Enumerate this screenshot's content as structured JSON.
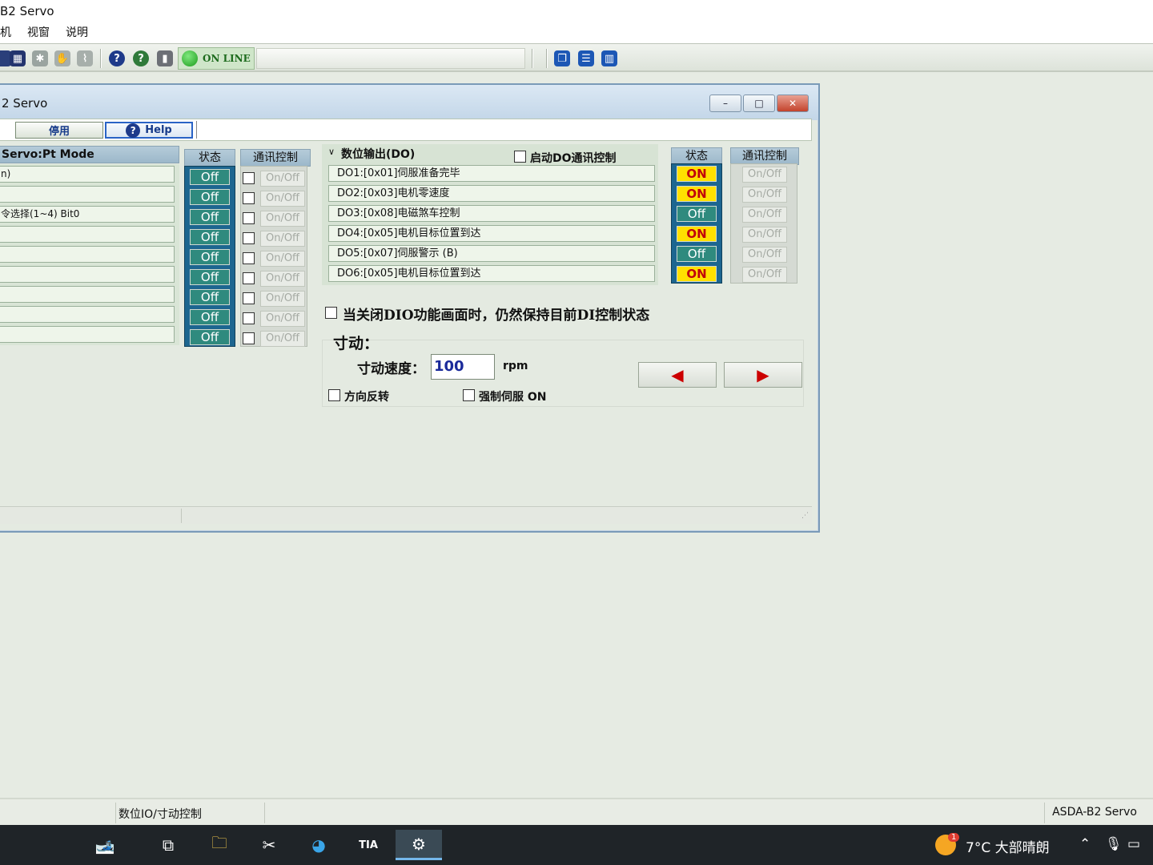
{
  "app": {
    "title": "B2 Servo",
    "menu": [
      "机",
      "视窗",
      "说明"
    ]
  },
  "toolbar": {
    "online_label": "ON LINE"
  },
  "window": {
    "title": "2 Servo",
    "buttons": {
      "minimize": "–",
      "restore": "□",
      "close": "✕"
    },
    "tool_disable": "停用",
    "tool_help": "Help"
  },
  "di": {
    "header": "Servo:Pt Mode",
    "state_header": "状态",
    "comm_header": "通讯控制",
    "rows": [
      {
        "label": "n)",
        "state": "Off",
        "comm": "On/Off"
      },
      {
        "label": "",
        "state": "Off",
        "comm": "On/Off"
      },
      {
        "label": "令选择(1~4) Bit0",
        "state": "Off",
        "comm": "On/Off"
      },
      {
        "label": "",
        "state": "Off",
        "comm": "On/Off"
      },
      {
        "label": "",
        "state": "Off",
        "comm": "On/Off"
      },
      {
        "label": "",
        "state": "Off",
        "comm": "On/Off"
      },
      {
        "label": "",
        "state": "Off",
        "comm": "On/Off"
      },
      {
        "label": "",
        "state": "Off",
        "comm": "On/Off"
      },
      {
        "label": "",
        "state": "Off",
        "comm": "On/Off"
      }
    ]
  },
  "do": {
    "header": "数位输出(DO)",
    "enable_comm": "启动DO通讯控制",
    "state_header": "状态",
    "comm_header": "通讯控制",
    "rows": [
      {
        "label": "DO1:[0x01]伺服准备完毕",
        "state": "ON",
        "comm": "On/Off"
      },
      {
        "label": "DO2:[0x03]电机零速度",
        "state": "ON",
        "comm": "On/Off"
      },
      {
        "label": "DO3:[0x08]电磁煞车控制",
        "state": "Off",
        "comm": "On/Off"
      },
      {
        "label": "DO4:[0x05]电机目标位置到达",
        "state": "ON",
        "comm": "On/Off"
      },
      {
        "label": "DO5:[0x07]伺服警示 (B)",
        "state": "Off",
        "comm": "On/Off"
      },
      {
        "label": "DO6:[0x05]电机目标位置到达",
        "state": "ON",
        "comm": "On/Off"
      }
    ]
  },
  "keep_state": "当关闭DIO功能画面时，仍然保持目前DI控制状态",
  "jog": {
    "title": "寸动：",
    "speed_label": "寸动速度：",
    "speed_value": "100",
    "unit": "rpm",
    "reverse": "方向反转",
    "force_servo": "强制伺服 ON",
    "left_arrow": "◀",
    "right_arrow": "▶"
  },
  "statusbar": {
    "left": "数位IO/寸动控制",
    "right": "ASDA-B2 Servo"
  },
  "taskbar": {
    "weather": "7°C 大部晴朗",
    "badge": "1"
  }
}
